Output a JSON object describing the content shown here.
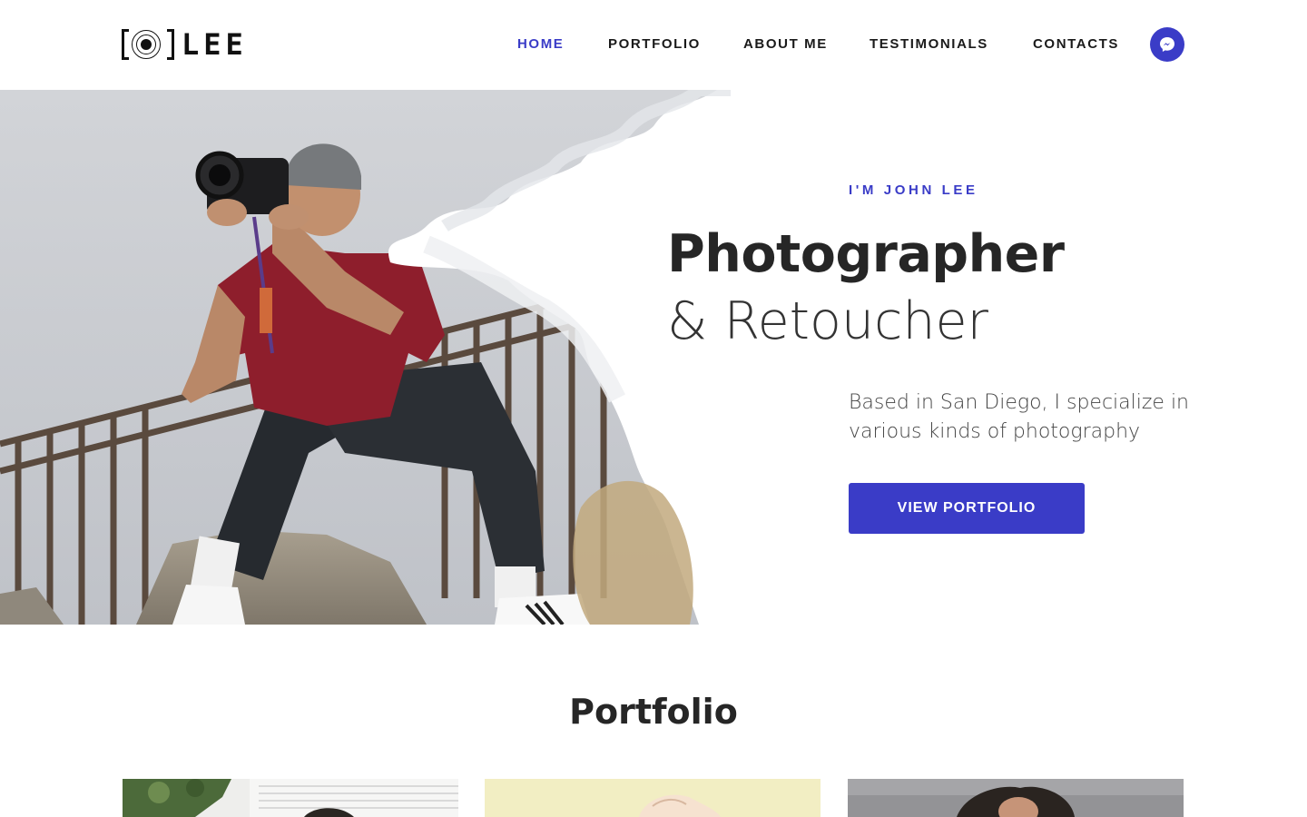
{
  "brand": {
    "name": "LEE"
  },
  "nav": {
    "items": [
      {
        "label": "HOME",
        "active": true
      },
      {
        "label": "PORTFOLIO",
        "active": false
      },
      {
        "label": "ABOUT ME",
        "active": false
      },
      {
        "label": "TESTIMONIALS",
        "active": false
      },
      {
        "label": "CONTACTS",
        "active": false
      }
    ],
    "messenger_icon": "messenger-icon"
  },
  "hero": {
    "kicker": "I'M JOHN LEE",
    "title": "Photographer",
    "subtitle": "& Retoucher",
    "text": "Based in San Diego, I specialize in various kinds of photography",
    "cta_label": "VIEW PORTFOLIO"
  },
  "portfolio": {
    "title": "Portfolio"
  },
  "colors": {
    "accent": "#3a3cc7",
    "text_dark": "#262626"
  }
}
